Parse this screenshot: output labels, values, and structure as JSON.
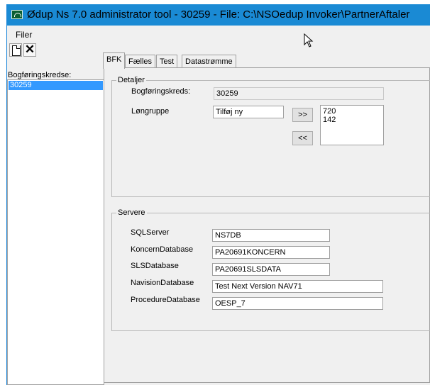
{
  "window": {
    "title": "Ødup Ns 7.0 administrator tool - 30259 - File: C:\\NSOedup Invoker\\PartnerAftaler"
  },
  "menu": {
    "file_label": "Filer"
  },
  "toolbar": {
    "new_icon": "new-document-icon",
    "delete_icon": "delete-x-icon",
    "delete_glyph": "✕"
  },
  "left_panel": {
    "label": "Bogføringskredse:",
    "items": [
      "30259"
    ]
  },
  "tabs": [
    "BFK",
    "Fælles",
    "Test",
    "Datastrømme"
  ],
  "details": {
    "group_title": "Detaljer",
    "bogforingskreds_label": "Bogføringskreds:",
    "bogforingskreds_value": "30259",
    "longruppe_label": "Løngruppe",
    "longruppe_value": "Tilføj ny",
    "add_button": ">>",
    "remove_button": "<<",
    "longrupper": "720\n142"
  },
  "servers": {
    "group_title": "Servere",
    "sqlserver_label": "SQLServer",
    "sqlserver_value": "NS7DB",
    "koncern_label": "KoncernDatabase",
    "koncern_value": "PA20691KONCERN",
    "sls_label": "SLSDatabase",
    "sls_value": "PA20691SLSDATA",
    "navision_label": "NavisionDatabase",
    "navision_value": "Test Next Version NAV71",
    "procedure_label": "ProcedureDatabase",
    "procedure_value": "OESP_7"
  },
  "colors": {
    "titlebar": "#1a8ad4",
    "selection": "#3399ff",
    "window_bg": "#f0f0f0"
  }
}
